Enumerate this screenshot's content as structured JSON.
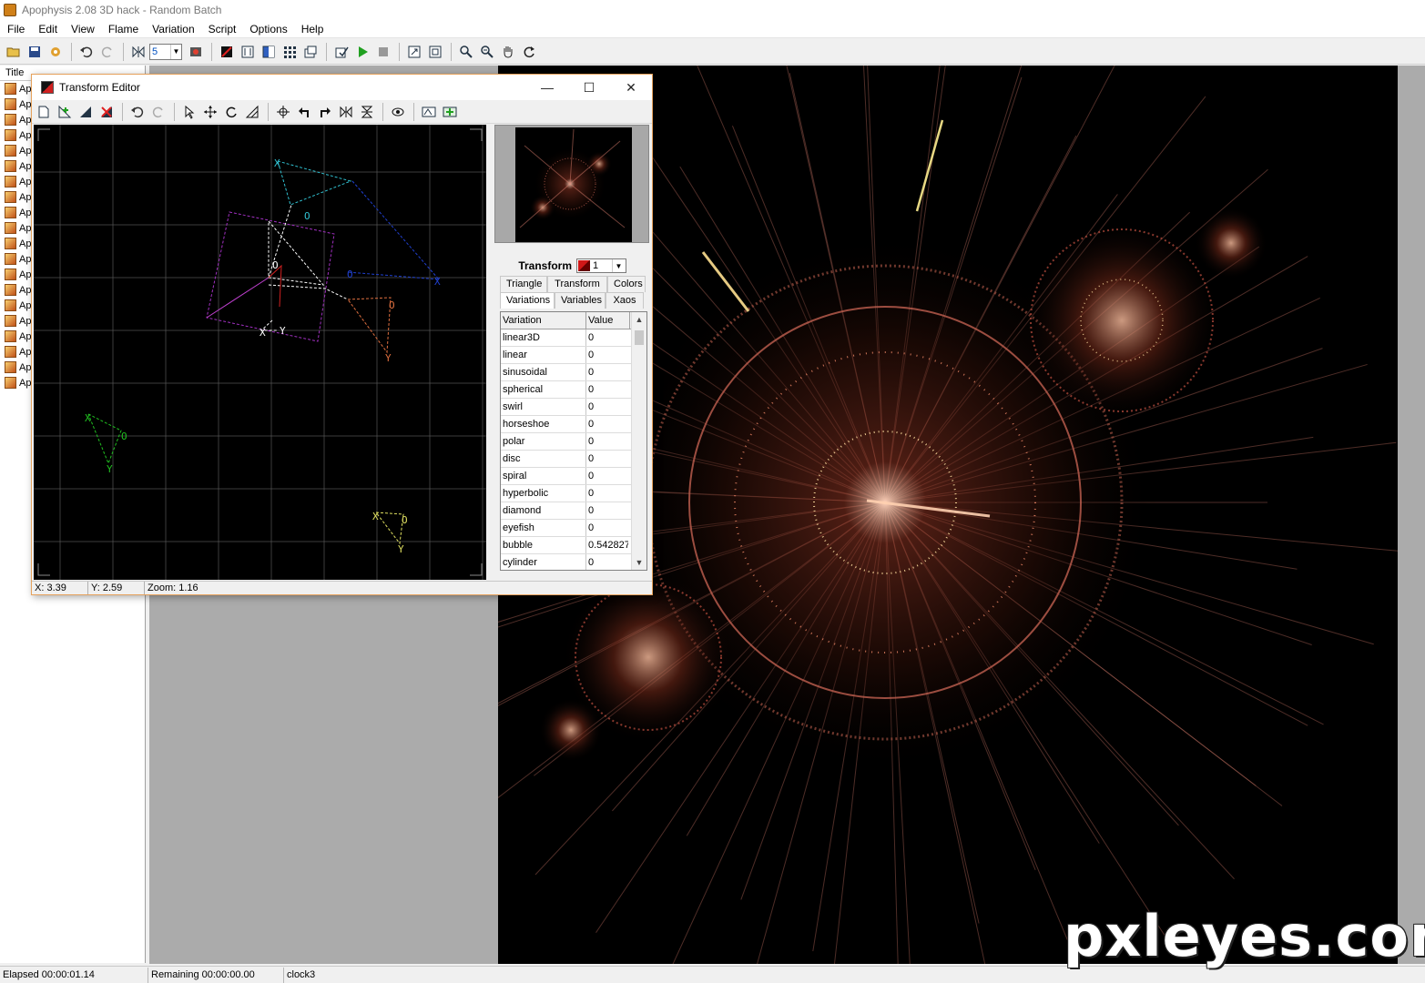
{
  "window": {
    "title": "Apophysis 2.08 3D hack - Random Batch"
  },
  "menu": [
    "File",
    "Edit",
    "View",
    "Flame",
    "Variation",
    "Script",
    "Options",
    "Help"
  ],
  "toolbar": {
    "batch_value": "5"
  },
  "list": {
    "header": "Title",
    "items": [
      "Ap",
      "Ap",
      "Ap",
      "Ap",
      "Ap",
      "Ap",
      "Ap",
      "Ap",
      "Ap",
      "Ap",
      "Ap",
      "Ap",
      "Ap",
      "Ap",
      "Ap",
      "Ap",
      "Ap",
      "Ap",
      "Ap",
      "Ap"
    ]
  },
  "transform_editor": {
    "title": "Transform Editor",
    "transform_label": "Transform",
    "transform_value": "1",
    "tabs_row1": [
      "Triangle",
      "Transform",
      "Colors"
    ],
    "tabs_row2": [
      "Variations",
      "Variables",
      "Xaos"
    ],
    "active_tab": "Variations",
    "grid": {
      "col_variation": "Variation",
      "col_value": "Value",
      "rows": [
        {
          "name": "linear3D",
          "value": "0"
        },
        {
          "name": "linear",
          "value": "0"
        },
        {
          "name": "sinusoidal",
          "value": "0"
        },
        {
          "name": "spherical",
          "value": "0"
        },
        {
          "name": "swirl",
          "value": "0"
        },
        {
          "name": "horseshoe",
          "value": "0"
        },
        {
          "name": "polar",
          "value": "0"
        },
        {
          "name": "disc",
          "value": "0"
        },
        {
          "name": "spiral",
          "value": "0"
        },
        {
          "name": "hyperbolic",
          "value": "0"
        },
        {
          "name": "diamond",
          "value": "0"
        },
        {
          "name": "eyefish",
          "value": "0"
        },
        {
          "name": "bubble",
          "value": "0.542827"
        },
        {
          "name": "cylinder",
          "value": "0"
        }
      ]
    },
    "status": {
      "x": "X: 3.39",
      "y": "Y: 2.59",
      "zoom": "Zoom: 1.16"
    },
    "triangle_labels": {
      "x": "X",
      "y": "Y",
      "o": "O"
    }
  },
  "statusbar": {
    "elapsed": "Elapsed 00:00:01.14",
    "remaining": "Remaining 00:00:00.00",
    "name": "clock3"
  },
  "watermark": "pxleyes.com",
  "colors": {
    "accent_border": "#e6a25c",
    "workspace": "#ababab",
    "flame_primary": "#e0604a"
  }
}
